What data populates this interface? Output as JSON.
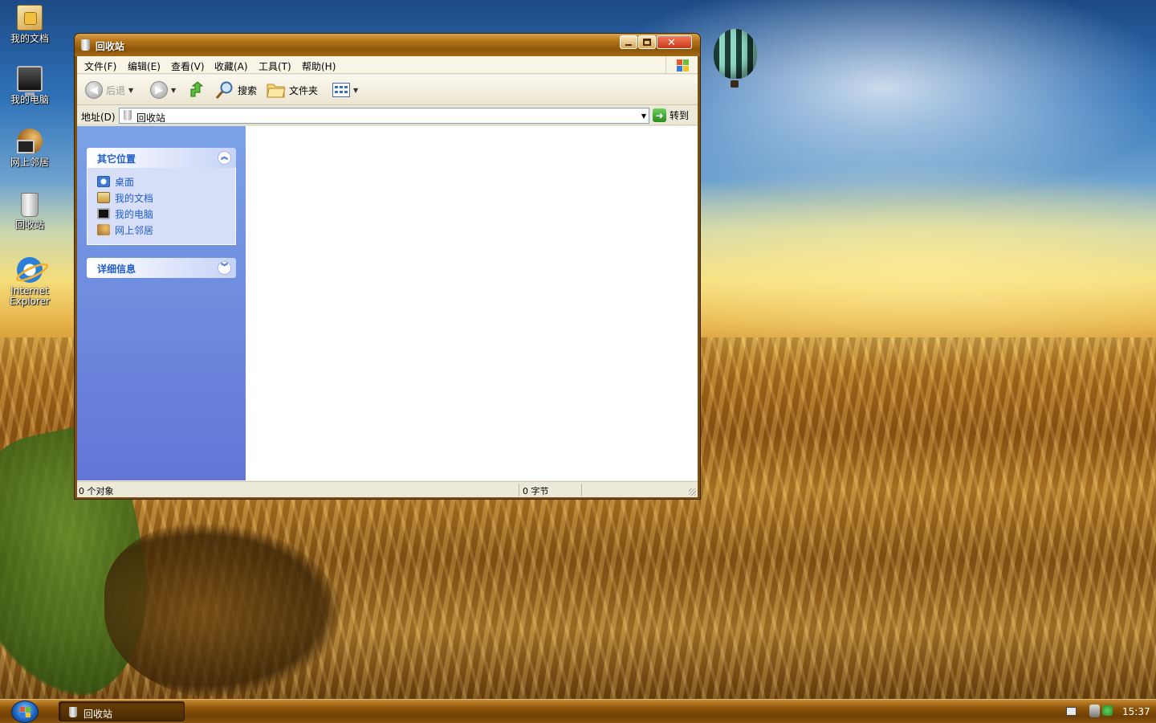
{
  "desktop": {
    "icons": [
      {
        "label": "我的文档",
        "icon": "my-documents-icon"
      },
      {
        "label": "我的电脑",
        "icon": "my-computer-icon"
      },
      {
        "label": "网上邻居",
        "icon": "network-places-icon"
      },
      {
        "label": "回收站",
        "icon": "recycle-bin-icon"
      },
      {
        "label": "Internet Explorer",
        "icon": "internet-explorer-icon"
      }
    ]
  },
  "window": {
    "title": "回收站",
    "menu": [
      "文件(F)",
      "编辑(E)",
      "查看(V)",
      "收藏(A)",
      "工具(T)",
      "帮助(H)"
    ],
    "toolbar": {
      "back_label": "后退",
      "search_label": "搜索",
      "folders_label": "文件夹"
    },
    "address": {
      "label": "地址(D)",
      "value": "回收站",
      "go_label": "转到"
    },
    "sidebar": {
      "other_places": {
        "title": "其它位置",
        "links": [
          {
            "label": "桌面",
            "icon": "desktop-icon"
          },
          {
            "label": "我的文档",
            "icon": "my-documents-icon"
          },
          {
            "label": "我的电脑",
            "icon": "my-computer-icon"
          },
          {
            "label": "网上邻居",
            "icon": "network-places-icon"
          }
        ]
      },
      "details": {
        "title": "详细信息"
      }
    },
    "status": {
      "objects": "0 个对象",
      "size": "0 字节"
    }
  },
  "taskbar": {
    "task_label": "回收站",
    "clock": "15:37"
  },
  "colors": {
    "title_gradient": "#b07117",
    "sidebar_top": "#7ba2e7",
    "sidebar_bottom": "#6375d6",
    "link": "#215dc6",
    "taskbar": "#8f5609"
  }
}
